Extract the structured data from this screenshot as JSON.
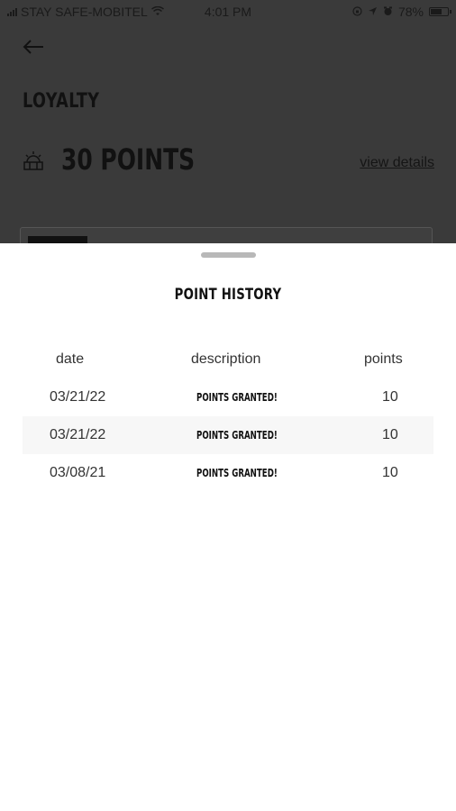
{
  "status_bar": {
    "carrier": "STAY SAFE-MOBITEL",
    "time": "4:01 PM",
    "battery_percent": "78%",
    "battery_level": 0.78
  },
  "background": {
    "title": "LOYALTY",
    "points_value": "30 POINTS",
    "view_details_link": "view details"
  },
  "sheet": {
    "title": "POINT HISTORY",
    "columns": [
      "date",
      "description",
      "points"
    ],
    "rows": [
      {
        "date": "03/21/22",
        "description": "POINTS GRANTED!",
        "points": "10"
      },
      {
        "date": "03/21/22",
        "description": "POINTS GRANTED!",
        "points": "10"
      },
      {
        "date": "03/08/21",
        "description": "POINTS GRANTED!",
        "points": "10"
      }
    ]
  },
  "icons": [
    "wifi-icon",
    "back-arrow-icon",
    "points-icon",
    "location-icon",
    "alarm-icon",
    "lock-rotation-icon",
    "battery-icon"
  ]
}
